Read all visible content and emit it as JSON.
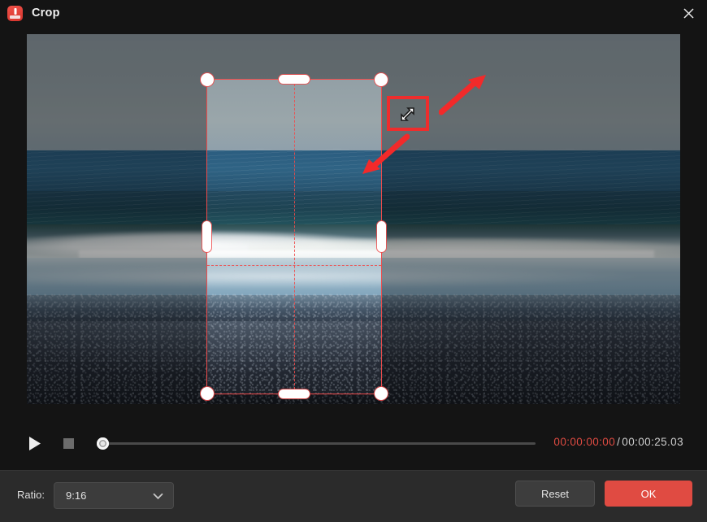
{
  "window": {
    "title": "Crop",
    "app_icon": "app-logo-icon",
    "close_icon": "close-icon",
    "accent_color": "#e04b42",
    "crop_outline_color": "#ef4b4b",
    "annotation_color": "#ee2d2d",
    "titlebar_background": "#141414",
    "bottombar_background": "#2b2b2b"
  },
  "preview": {
    "media_description": "beach-video-frame",
    "crop_overlay": {
      "name": "crop-rectangle",
      "grid_lines": [
        "vertical-center",
        "horizontal-third"
      ],
      "handles": [
        "top-left-corner",
        "top-center",
        "top-right-corner",
        "left-center",
        "right-center",
        "bottom-left-corner",
        "bottom-center",
        "bottom-right-corner"
      ],
      "highlighted_handle": "top-right-corner",
      "cursor": "diagonal-resize-cursor"
    },
    "annotations": [
      {
        "name": "arrow-to-corner-handle",
        "direction": "up-right"
      },
      {
        "name": "arrow-into-crop-box",
        "direction": "down-left"
      }
    ]
  },
  "transport": {
    "play_icon": "play-icon",
    "stop_icon": "stop-icon",
    "seek_handle": "seek-handle",
    "current_time": "00:00:00:00",
    "separator": "/",
    "total_time": "00:00:25.03",
    "current_time_color": "#e04b42"
  },
  "footer": {
    "ratio_label": "Ratio:",
    "ratio_value": "9:16",
    "ratio_chevron": "chevron-down-icon",
    "reset_label": "Reset",
    "ok_label": "OK"
  }
}
